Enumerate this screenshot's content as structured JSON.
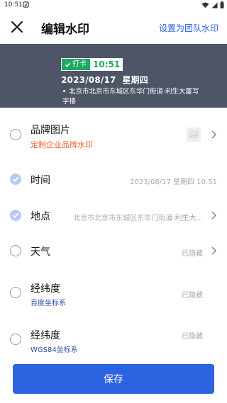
{
  "status_bar": {
    "time": "10:51",
    "icons": [
      "app-notification-icon",
      "wifi-icon",
      "signal-icon",
      "battery-icon"
    ]
  },
  "header": {
    "title": "编辑水印",
    "team_link": "设置为团队水印",
    "close_icon": "close-icon"
  },
  "preview": {
    "punch_label": "打卡",
    "punch_time": "10:51",
    "date_line": "2023/08/17  星期四",
    "location": "北京市北京市东城区东华门街道·利生大厦写字楼",
    "colors": {
      "background": "#4d5566",
      "tag": "#1faa63"
    }
  },
  "rows": [
    {
      "label": "品牌图片",
      "sub": "定制企业品牌水印",
      "value": "",
      "checked": false
    },
    {
      "label": "时间",
      "sub": "",
      "value": "2023/08/17 星期四 10:51",
      "checked": true
    },
    {
      "label": "地点",
      "sub": "",
      "value": "北京市北京市东城区东华门街道·利生大...",
      "checked": true
    },
    {
      "label": "天气",
      "sub": "",
      "value": "已隐藏",
      "checked": false
    },
    {
      "label": "经纬度",
      "sub": "百度坐标系",
      "value": "已隐藏",
      "checked": false
    },
    {
      "label": "经纬度",
      "sub": "WGS84坐标系",
      "value": "已隐藏",
      "checked": false
    }
  ],
  "save_label": "保存",
  "colors": {
    "accent": "#2b63e0",
    "highlight_sub": "#f0642a",
    "blue_sub": "#2b4fa6"
  }
}
